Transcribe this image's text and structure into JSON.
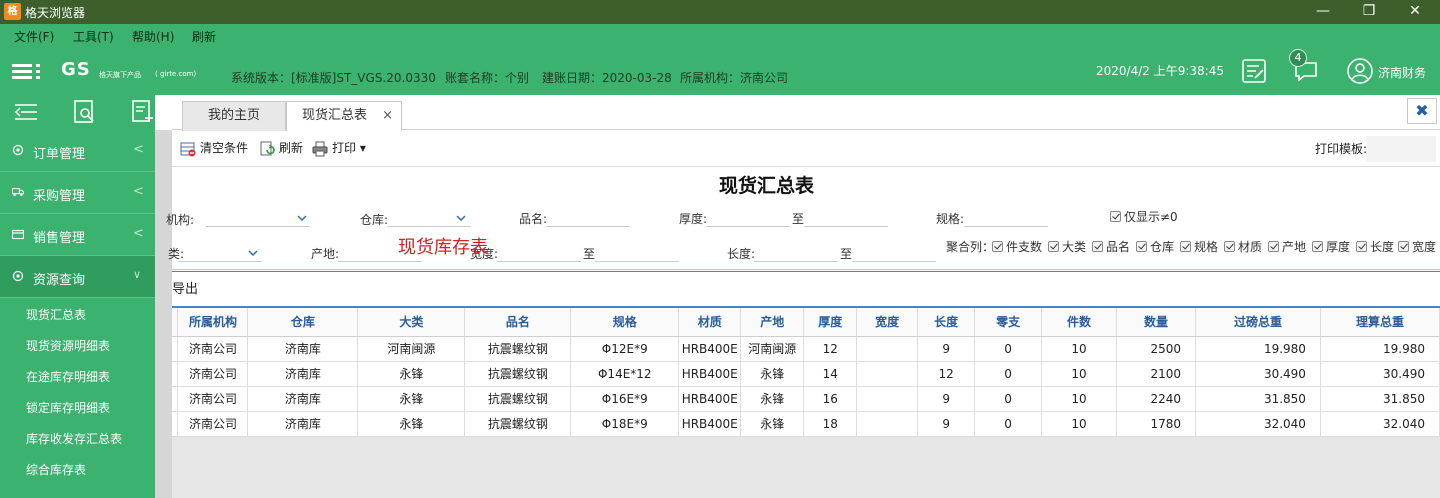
{
  "window": {
    "title": "格天浏览器",
    "logo_text": "格",
    "controls": {
      "minimize": "—",
      "maximize": "❐",
      "close": "✕"
    }
  },
  "menu": [
    "文件(F)",
    "工具(T)",
    "帮助(H)",
    "刷新"
  ],
  "header": {
    "brand": "GS",
    "brand_sub": "格天旗下产品",
    "brand_url": "( girte.com)",
    "system_version": "系统版本：[标准版]ST_VGS.20.0330",
    "account_name": "账套名称：个别",
    "build_date": "建账日期：2020-03-28",
    "org": "所属机构：济南公司",
    "datetime": "2020/4/2 上午9:38:45",
    "message_count": "4",
    "username": "济南财务"
  },
  "sidebar": {
    "nav": [
      {
        "label": "订单管理",
        "icon": "gear-icon",
        "chevron": "<"
      },
      {
        "label": "采购管理",
        "icon": "truck-icon",
        "chevron": "<"
      },
      {
        "label": "销售管理",
        "icon": "wallet-icon",
        "chevron": "<"
      },
      {
        "label": "资源查询",
        "icon": "gear-icon",
        "chevron": "∨"
      }
    ],
    "sub": [
      "现货汇总表",
      "现货资源明细表",
      "在途库存明细表",
      "锁定库存明细表",
      "库存收发存汇总表",
      "综合库存表"
    ]
  },
  "tabs": [
    {
      "label": "我的主页"
    },
    {
      "label": "现货汇总表",
      "close": "×"
    }
  ],
  "close_all": "✖",
  "toolbar": {
    "clear": "清空条件",
    "refresh": "刷新",
    "print": "打印",
    "print_caret": "▾",
    "print_template": "打印模板:"
  },
  "report": {
    "title": "现货汇总表",
    "overlay_label": "现货库存表",
    "filters": {
      "org": "机构:",
      "warehouse": "仓库:",
      "product": "品名:",
      "thickness": "厚度:",
      "to": "至",
      "spec": "规格:",
      "only_nonzero": "仅显示≠0",
      "category": "类:",
      "origin": "产地:",
      "width": "宽度:",
      "length": "长度:"
    },
    "group_by_label": "聚合列：",
    "group_by": [
      "件支数",
      "大类",
      "品名",
      "仓库",
      "规格",
      "材质",
      "产地",
      "厚度",
      "长度",
      "宽度"
    ]
  },
  "export_label": "导出",
  "table": {
    "columns": [
      "",
      "所属机构",
      "仓库",
      "大类",
      "品名",
      "规格",
      "材质",
      "产地",
      "厚度",
      "宽度",
      "长度",
      "零支",
      "件数",
      "数量",
      "过磅总重",
      "理算总重"
    ],
    "rows": [
      [
        "",
        "济南公司",
        "济南库",
        "河南闽源",
        "抗震螺纹钢",
        "Φ12E*9",
        "HRB400E",
        "河南闽源",
        "12",
        "",
        "9",
        "0",
        "10",
        "2500",
        "19.980",
        "19.980"
      ],
      [
        "",
        "济南公司",
        "济南库",
        "永锋",
        "抗震螺纹钢",
        "Φ14E*12",
        "HRB400E",
        "永锋",
        "14",
        "",
        "12",
        "0",
        "10",
        "2100",
        "30.490",
        "30.490"
      ],
      [
        "",
        "济南公司",
        "济南库",
        "永锋",
        "抗震螺纹钢",
        "Φ16E*9",
        "HRB400E",
        "永锋",
        "16",
        "",
        "9",
        "0",
        "10",
        "2240",
        "31.850",
        "31.850"
      ],
      [
        "",
        "济南公司",
        "济南库",
        "永锋",
        "抗震螺纹钢",
        "Φ18E*9",
        "HRB400E",
        "永锋",
        "18",
        "",
        "9",
        "0",
        "10",
        "1780",
        "32.040",
        "32.040"
      ]
    ]
  }
}
